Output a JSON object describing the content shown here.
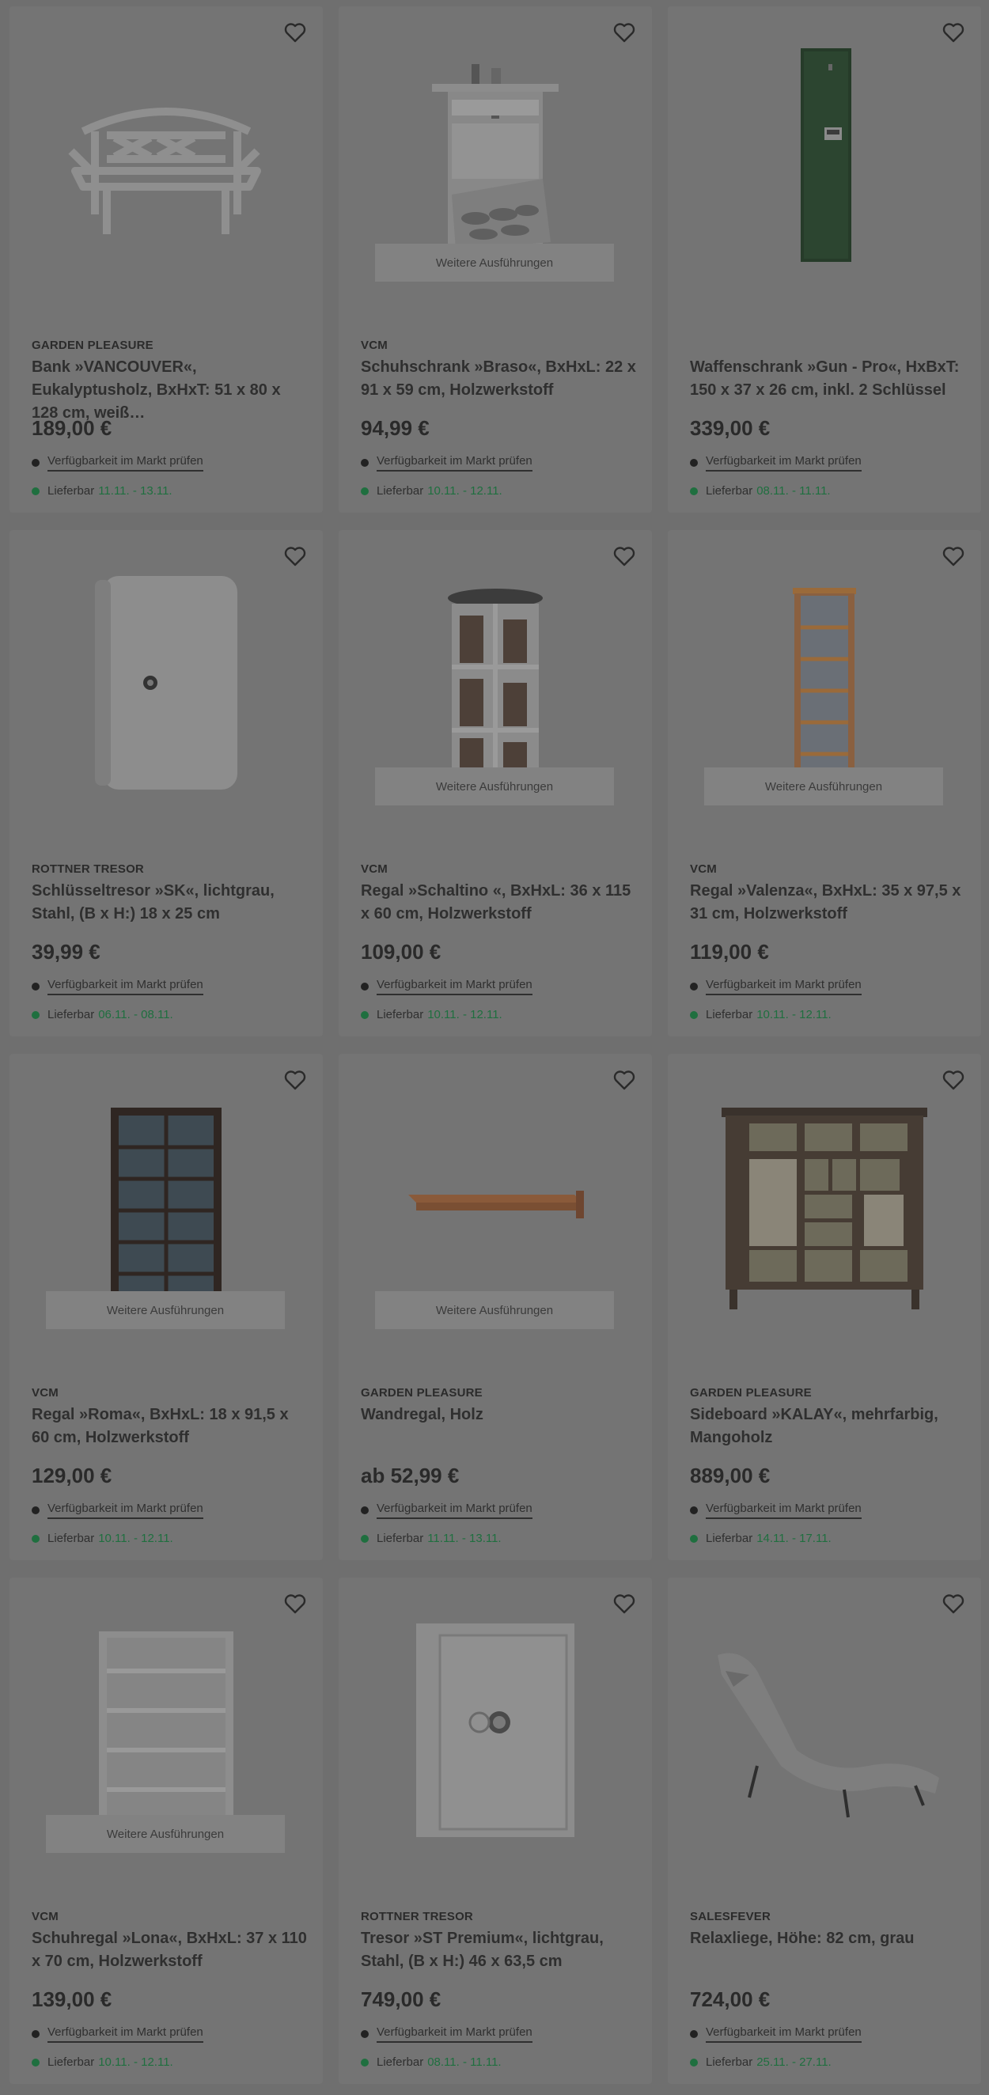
{
  "labels": {
    "availability": "Verfügbarkeit im Markt prüfen",
    "delivery": "Lieferbar",
    "variants": "Weitere Ausführungen"
  },
  "products": [
    {
      "brand": "GARDEN PLEASURE",
      "title": "Bank »VANCOUVER«, Eukalyptusholz, BxHxT: 51 x 80 x 128 cm, weiß…",
      "price": "189,00 €",
      "delivery_date": "11.11. - 13.11.",
      "variants": false,
      "image": "bench-icon"
    },
    {
      "brand": "VCM",
      "title": "Schuhschrank »Braso«, BxHxL: 22 x 91 x 59 cm, Holzwerkstoff",
      "price": "94,99 €",
      "delivery_date": "10.11. - 12.11.",
      "variants": true,
      "image": "shoe-cabinet-icon"
    },
    {
      "brand": "",
      "title": "Waffenschrank »Gun - Pro«, HxBxT: 150 x 37 x 26 cm, inkl. 2 Schlüssel",
      "price": "339,00 €",
      "delivery_date": "08.11. - 11.11.",
      "variants": false,
      "image": "gun-safe-icon"
    },
    {
      "brand": "ROTTNER TRESOR",
      "title": "Schlüsseltresor »SK«, lichtgrau, Stahl, (B x H:) 18 x 25 cm",
      "price": "39,99 €",
      "delivery_date": "06.11. - 08.11.",
      "variants": false,
      "image": "key-safe-icon"
    },
    {
      "brand": "VCM",
      "title": "Regal »Schaltino «, BxHxL: 36 x 115 x 60 cm, Holzwerkstoff",
      "price": "109,00 €",
      "delivery_date": "10.11. - 12.11.",
      "variants": true,
      "image": "record-shelf-icon"
    },
    {
      "brand": "VCM",
      "title": "Regal »Valenza«, BxHxL: 35 x 97,5 x 31 cm, Holzwerkstoff",
      "price": "119,00 €",
      "delivery_date": "10.11. - 12.11.",
      "variants": true,
      "image": "cd-tower-icon"
    },
    {
      "brand": "VCM",
      "title": "Regal »Roma«, BxHxL: 18 x 91,5 x 60 cm, Holzwerkstoff",
      "price": "129,00 €",
      "delivery_date": "10.11. - 12.11.",
      "variants": true,
      "image": "media-shelf-icon"
    },
    {
      "brand": "GARDEN PLEASURE",
      "title": "Wandregal, Holz",
      "price": "ab 52,99 €",
      "delivery_date": "11.11. - 13.11.",
      "variants": true,
      "image": "wall-shelf-icon"
    },
    {
      "brand": "GARDEN PLEASURE",
      "title": "Sideboard »KALAY«, mehrfarbig, Mangoholz",
      "price": "889,00 €",
      "delivery_date": "14.11. - 17.11.",
      "variants": false,
      "image": "sideboard-icon"
    },
    {
      "brand": "VCM",
      "title": "Schuhregal »Lona«, BxHxL: 37 x 110 x 70 cm, Holzwerkstoff",
      "price": "139,00 €",
      "delivery_date": "10.11. - 12.11.",
      "variants": true,
      "image": "shoe-rack-icon"
    },
    {
      "brand": "ROTTNER TRESOR",
      "title": "Tresor »ST Premium«, lichtgrau, Stahl, (B x H:) 46 x 63,5 cm",
      "price": "749,00 €",
      "delivery_date": "08.11. - 11.11.",
      "variants": false,
      "image": "safe-icon"
    },
    {
      "brand": "SALESFEVER",
      "title": "Relaxliege, Höhe: 82 cm, grau",
      "price": "724,00 €",
      "delivery_date": "25.11. - 27.11.",
      "variants": false,
      "image": "lounger-icon"
    }
  ]
}
